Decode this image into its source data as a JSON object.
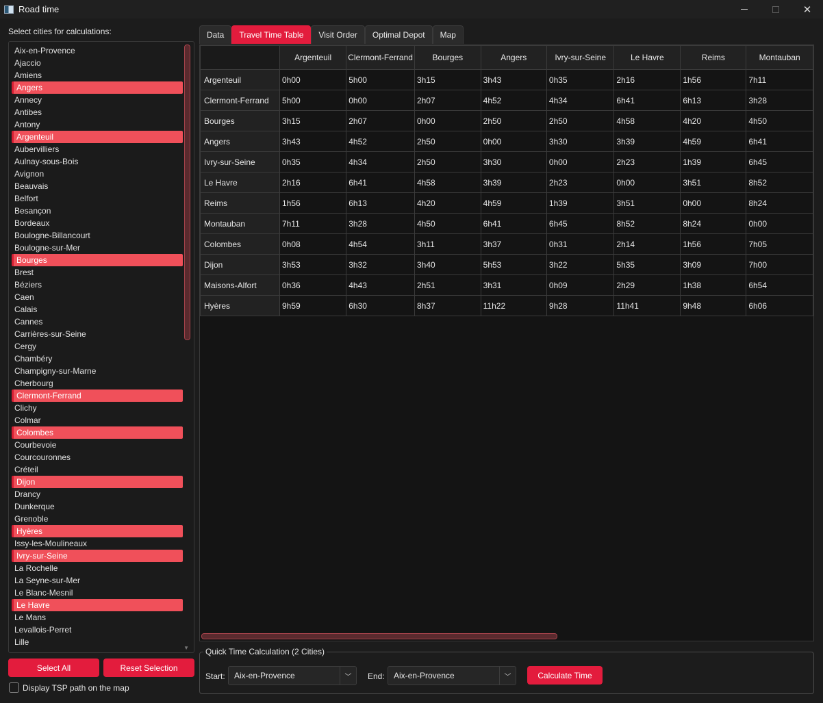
{
  "window": {
    "title": "Road time"
  },
  "sidebar": {
    "label": "Select cities for calculations:",
    "cities": [
      {
        "name": "Aix-en-Provence",
        "selected": false
      },
      {
        "name": "Ajaccio",
        "selected": false
      },
      {
        "name": "Amiens",
        "selected": false
      },
      {
        "name": "Angers",
        "selected": true
      },
      {
        "name": "Annecy",
        "selected": false
      },
      {
        "name": "Antibes",
        "selected": false
      },
      {
        "name": "Antony",
        "selected": false
      },
      {
        "name": "Argenteuil",
        "selected": true
      },
      {
        "name": "Aubervilliers",
        "selected": false
      },
      {
        "name": "Aulnay-sous-Bois",
        "selected": false
      },
      {
        "name": "Avignon",
        "selected": false
      },
      {
        "name": "Beauvais",
        "selected": false
      },
      {
        "name": "Belfort",
        "selected": false
      },
      {
        "name": "Besançon",
        "selected": false
      },
      {
        "name": "Bordeaux",
        "selected": false
      },
      {
        "name": "Boulogne-Billancourt",
        "selected": false
      },
      {
        "name": "Boulogne-sur-Mer",
        "selected": false
      },
      {
        "name": "Bourges",
        "selected": true
      },
      {
        "name": "Brest",
        "selected": false
      },
      {
        "name": "Béziers",
        "selected": false
      },
      {
        "name": "Caen",
        "selected": false
      },
      {
        "name": "Calais",
        "selected": false
      },
      {
        "name": "Cannes",
        "selected": false
      },
      {
        "name": "Carrières-sur-Seine",
        "selected": false
      },
      {
        "name": "Cergy",
        "selected": false
      },
      {
        "name": "Chambéry",
        "selected": false
      },
      {
        "name": "Champigny-sur-Marne",
        "selected": false
      },
      {
        "name": "Cherbourg",
        "selected": false
      },
      {
        "name": "Clermont-Ferrand",
        "selected": true
      },
      {
        "name": "Clichy",
        "selected": false
      },
      {
        "name": "Colmar",
        "selected": false
      },
      {
        "name": "Colombes",
        "selected": true
      },
      {
        "name": "Courbevoie",
        "selected": false
      },
      {
        "name": "Courcouronnes",
        "selected": false
      },
      {
        "name": "Créteil",
        "selected": false
      },
      {
        "name": "Dijon",
        "selected": true
      },
      {
        "name": "Drancy",
        "selected": false
      },
      {
        "name": "Dunkerque",
        "selected": false
      },
      {
        "name": "Grenoble",
        "selected": false
      },
      {
        "name": "Hyères",
        "selected": true
      },
      {
        "name": "Issy-les-Moulineaux",
        "selected": false
      },
      {
        "name": "Ivry-sur-Seine",
        "selected": true
      },
      {
        "name": "La Rochelle",
        "selected": false
      },
      {
        "name": "La Seyne-sur-Mer",
        "selected": false
      },
      {
        "name": "Le Blanc-Mesnil",
        "selected": false
      },
      {
        "name": "Le Havre",
        "selected": true
      },
      {
        "name": "Le Mans",
        "selected": false
      },
      {
        "name": "Levallois-Perret",
        "selected": false
      },
      {
        "name": "Lille",
        "selected": false
      }
    ],
    "select_all_label": "Select All",
    "reset_label": "Reset Selection",
    "tsp_label": "Display TSP path on the map"
  },
  "tabs": [
    {
      "label": "Data",
      "active": false
    },
    {
      "label": "Travel Time Table",
      "active": true
    },
    {
      "label": "Visit Order",
      "active": false
    },
    {
      "label": "Optimal Depot",
      "active": false
    },
    {
      "label": "Map",
      "active": false
    }
  ],
  "table": {
    "columns": [
      "Argenteuil",
      "Clermont-Ferrand",
      "Bourges",
      "Angers",
      "Ivry-sur-Seine",
      "Le Havre",
      "Reims",
      "Montauban"
    ],
    "rows": [
      {
        "city": "Argenteuil",
        "values": [
          "0h00",
          "5h00",
          "3h15",
          "3h43",
          "0h35",
          "2h16",
          "1h56",
          "7h11"
        ]
      },
      {
        "city": "Clermont-Ferrand",
        "values": [
          "5h00",
          "0h00",
          "2h07",
          "4h52",
          "4h34",
          "6h41",
          "6h13",
          "3h28"
        ]
      },
      {
        "city": "Bourges",
        "values": [
          "3h15",
          "2h07",
          "0h00",
          "2h50",
          "2h50",
          "4h58",
          "4h20",
          "4h50"
        ]
      },
      {
        "city": "Angers",
        "values": [
          "3h43",
          "4h52",
          "2h50",
          "0h00",
          "3h30",
          "3h39",
          "4h59",
          "6h41"
        ]
      },
      {
        "city": "Ivry-sur-Seine",
        "values": [
          "0h35",
          "4h34",
          "2h50",
          "3h30",
          "0h00",
          "2h23",
          "1h39",
          "6h45"
        ]
      },
      {
        "city": "Le Havre",
        "values": [
          "2h16",
          "6h41",
          "4h58",
          "3h39",
          "2h23",
          "0h00",
          "3h51",
          "8h52"
        ]
      },
      {
        "city": "Reims",
        "values": [
          "1h56",
          "6h13",
          "4h20",
          "4h59",
          "1h39",
          "3h51",
          "0h00",
          "8h24"
        ]
      },
      {
        "city": "Montauban",
        "values": [
          "7h11",
          "3h28",
          "4h50",
          "6h41",
          "6h45",
          "8h52",
          "8h24",
          "0h00"
        ]
      },
      {
        "city": "Colombes",
        "values": [
          "0h08",
          "4h54",
          "3h11",
          "3h37",
          "0h31",
          "2h14",
          "1h56",
          "7h05"
        ]
      },
      {
        "city": "Dijon",
        "values": [
          "3h53",
          "3h32",
          "3h40",
          "5h53",
          "3h22",
          "5h35",
          "3h09",
          "7h00"
        ]
      },
      {
        "city": "Maisons-Alfort",
        "values": [
          "0h36",
          "4h43",
          "2h51",
          "3h31",
          "0h09",
          "2h29",
          "1h38",
          "6h54"
        ]
      },
      {
        "city": "Hyères",
        "values": [
          "9h59",
          "6h30",
          "8h37",
          "11h22",
          "9h28",
          "11h41",
          "9h48",
          "6h06"
        ]
      }
    ]
  },
  "quick_calc": {
    "title": "Quick Time Calculation (2 Cities)",
    "start_label": "Start:",
    "start_value": "Aix-en-Provence",
    "end_label": "End:",
    "end_value": "Aix-en-Provence",
    "calc_label": "Calculate Time"
  },
  "colors": {
    "accent": "#e31c3d",
    "selection": "#f0505a"
  }
}
